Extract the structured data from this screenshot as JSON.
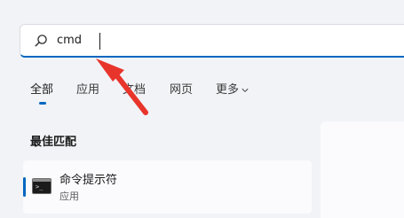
{
  "search": {
    "value": "cmd",
    "icon": "search-icon"
  },
  "tabs": [
    {
      "label": "全部",
      "active": true
    },
    {
      "label": "应用"
    },
    {
      "label": "文档"
    },
    {
      "label": "网页"
    },
    {
      "label": "更多",
      "icon": "chevron-down-icon"
    }
  ],
  "best_match": {
    "title": "最佳匹配",
    "result": {
      "name": "命令提示符",
      "type": "应用",
      "icon": "command-prompt-icon"
    }
  },
  "colors": {
    "accent": "#0067c0",
    "annotation_arrow": "#e8352c",
    "background": "#f2f3f7"
  }
}
